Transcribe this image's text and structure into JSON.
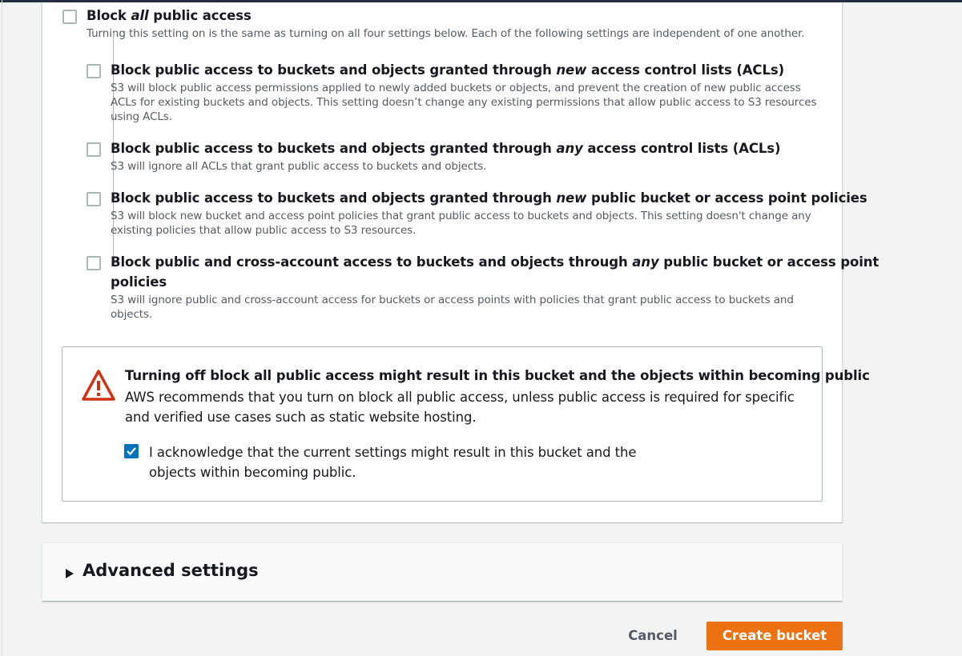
{
  "block_all": {
    "title_prefix": "Block ",
    "title_emphasis": "all",
    "title_suffix": " public access",
    "description": "Turning this setting on is the same as turning on all four settings below. Each of the following settings are independent of one another.",
    "checked": false
  },
  "settings": [
    {
      "title_prefix": "Block public access to buckets and objects granted through ",
      "title_emphasis": "new",
      "title_suffix": " access control lists (ACLs)",
      "description": "S3 will block public access permissions applied to newly added buckets or objects, and prevent the creation of new public access ACLs for existing buckets and objects. This setting doesn’t change any existing permissions that allow public access to S3 resources using ACLs.",
      "checked": false
    },
    {
      "title_prefix": "Block public access to buckets and objects granted through ",
      "title_emphasis": "any",
      "title_suffix": " access control lists (ACLs)",
      "description": "S3 will ignore all ACLs that grant public access to buckets and objects.",
      "checked": false
    },
    {
      "title_prefix": "Block public access to buckets and objects granted through ",
      "title_emphasis": "new",
      "title_suffix": " public bucket or access point policies",
      "description": "S3 will block new bucket and access point policies that grant public access to buckets and objects. This setting doesn't change any existing policies that allow public access to S3 resources.",
      "checked": false
    },
    {
      "title_prefix": "Block public and cross-account access to buckets and objects through ",
      "title_emphasis": "any",
      "title_suffix": " public bucket or access point",
      "title_line2": "policies",
      "description": "S3 will ignore public and cross-account access for buckets or access points with policies that grant public access to buckets and objects.",
      "checked": false
    }
  ],
  "warning": {
    "icon": "warning-triangle-icon",
    "title": "Turning off block all public access might result in this bucket and the objects within becoming public",
    "text": "AWS recommends that you turn on block all public access, unless public access is required for specific and verified use cases such as static website hosting.",
    "acknowledge_text": "I acknowledge that the current settings might result in this bucket and the objects within becoming public.",
    "acknowledge_checked": true,
    "color": "#d13212"
  },
  "advanced": {
    "label": "Advanced settings",
    "expanded": false
  },
  "actions": {
    "cancel_label": "Cancel",
    "create_label": "Create bucket",
    "primary_color": "#ec7211"
  }
}
